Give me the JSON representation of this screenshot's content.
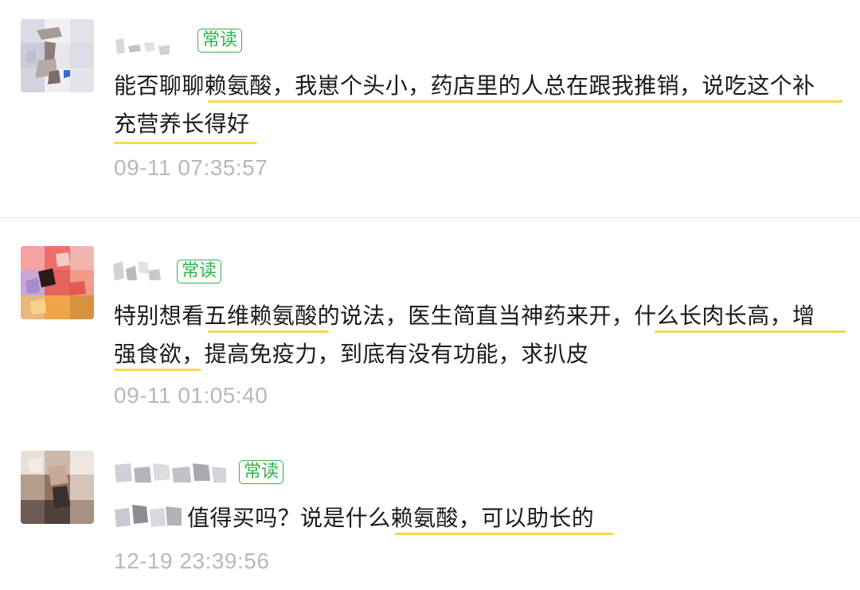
{
  "badge_label": "常读",
  "colors": {
    "badge": "#2fb34a",
    "highlight_underline": "#f7d84c",
    "timestamp": "#b8b8b8"
  },
  "comments": [
    {
      "line1": "能否聊聊赖氨酸，我崽个头小，药店里的人总在跟我推销，说吃这个补",
      "line2": "充营养长得好",
      "time": "09-11 07:35:57"
    },
    {
      "line1": "特别想看五维赖氨酸的说法，医生简直当神药来开，什么长肉长高，增",
      "line2": "强食欲，提高免疫力，到底有没有功能，求扒皮",
      "time": "09-11 01:05:40"
    },
    {
      "line1": "值得买吗？说是什么赖氨酸，可以助长的",
      "time": "12-19 23:39:56"
    }
  ]
}
